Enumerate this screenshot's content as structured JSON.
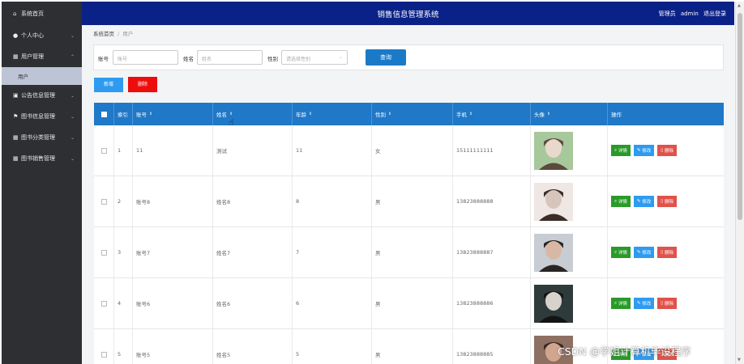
{
  "sidebar": {
    "items": [
      {
        "label": "系统首页",
        "icon": "home-icon",
        "glyph": "⌂",
        "chevron": false
      },
      {
        "label": "个人中心",
        "icon": "user-icon",
        "glyph": "●",
        "chevron": "⌄"
      },
      {
        "label": "用户管理",
        "icon": "grid-icon",
        "glyph": "▦",
        "chevron": "⌃"
      },
      {
        "label": "公告信息管理",
        "icon": "briefcase-icon",
        "glyph": "▣",
        "chevron": "⌄"
      },
      {
        "label": "图书信息管理",
        "icon": "flag-icon",
        "glyph": "⚑",
        "chevron": "⌄"
      },
      {
        "label": "图书分类管理",
        "icon": "grid-icon",
        "glyph": "▦",
        "chevron": "⌄"
      },
      {
        "label": "图书销售管理",
        "icon": "grid-icon",
        "glyph": "▦",
        "chevron": "⌄"
      }
    ],
    "sub_item": "用户"
  },
  "header": {
    "title": "销售信息管理系统",
    "user_prefix": "管理员",
    "username": "admin",
    "logout": "退出登录"
  },
  "breadcrumb": {
    "home": "系统首页",
    "sep": "/",
    "current": "用户"
  },
  "search": {
    "account_label": "账号",
    "account_placeholder": "账号",
    "name_label": "姓名",
    "name_placeholder": "姓名",
    "gender_label": "性别",
    "gender_placeholder": "请选择性别",
    "query_button": "查询"
  },
  "actions": {
    "add": "新增",
    "delete": "删除"
  },
  "table": {
    "headers": [
      "索引",
      "账号",
      "姓名",
      "年龄",
      "性别",
      "手机",
      "头像",
      "操作"
    ],
    "sort_glyph": "⇕",
    "rows": [
      {
        "index": "1",
        "account": "11",
        "name": "测试",
        "age": "11",
        "gender": "女",
        "phone": "15111111111",
        "avatar_colors": [
          "#a7c89b",
          "#e9d9cc",
          "#5c4a3e"
        ]
      },
      {
        "index": "2",
        "account": "账号8",
        "name": "姓名8",
        "age": "8",
        "gender": "男",
        "phone": "13823888888",
        "avatar_colors": [
          "#efe7e3",
          "#d7c5bc",
          "#3a2c26"
        ]
      },
      {
        "index": "3",
        "account": "账号7",
        "name": "姓名7",
        "age": "7",
        "gender": "男",
        "phone": "13823888887",
        "avatar_colors": [
          "#c7cdd3",
          "#d8b8a4",
          "#2a2522"
        ]
      },
      {
        "index": "4",
        "account": "账号6",
        "name": "姓名6",
        "age": "6",
        "gender": "男",
        "phone": "13823888886",
        "avatar_colors": [
          "#2f3a3b",
          "#d8d2cc",
          "#141414"
        ]
      },
      {
        "index": "5",
        "account": "账号5",
        "name": "姓名5",
        "age": "5",
        "gender": "男",
        "phone": "13823888885",
        "avatar_colors": [
          "#8e7062",
          "#d2a68e",
          "#3a2a22"
        ]
      }
    ],
    "row_actions": {
      "detail": "详情",
      "edit": "修改",
      "delete": "删除"
    }
  },
  "watermark": "CSDN @学姐计算机毕设程序",
  "colors": {
    "sidebar_bg": "#2d2f33",
    "header_bg": "#0a2187",
    "table_header_bg": "#1f78c8",
    "add_button": "#2e9bf0",
    "delete_button": "#ee0d0d",
    "detail_button": "#2a9a2a",
    "edit_button": "#2e9bf0",
    "row_delete_button": "#e0524a"
  }
}
